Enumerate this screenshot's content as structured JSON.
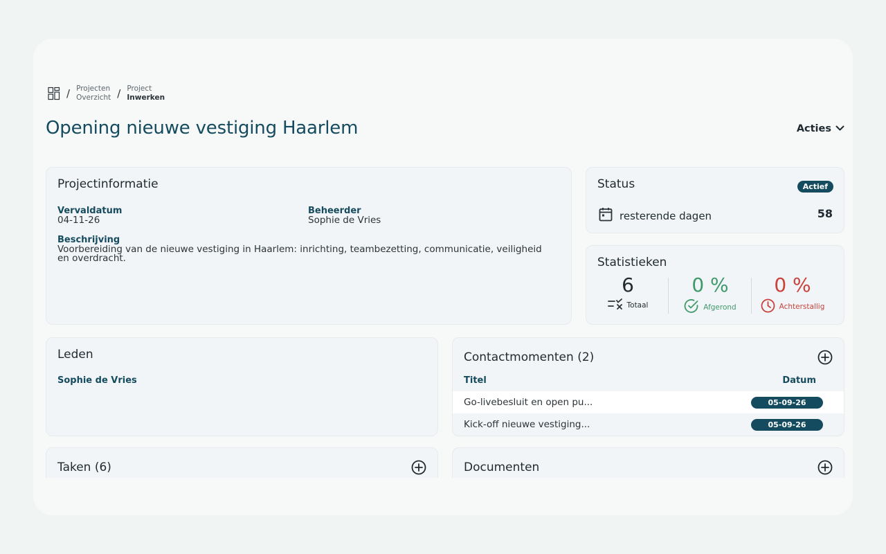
{
  "breadcrumb": [
    {
      "top": "Projecten",
      "bottom": "Overzicht"
    },
    {
      "top": "Project",
      "bottom": "Inwerken"
    }
  ],
  "page_title": "Opening nieuwe vestiging Haarlem",
  "actions_label": "Acties",
  "project_info": {
    "title": "Projectinformatie",
    "due_label": "Vervaldatum",
    "due_value": "04-11-26",
    "manager_label": "Beheerder",
    "manager_value": "Sophie de Vries",
    "description_label": "Beschrijving",
    "description_value": "Voorbereiding van de nieuwe vestiging in Haarlem: inrichting, teambezetting, communicatie, veiligheid en overdracht."
  },
  "status": {
    "title": "Status",
    "badge": "Actief",
    "days_label": "resterende dagen",
    "days_value": "58"
  },
  "statistics": {
    "title": "Statistieken",
    "total_value": "6",
    "total_label": "Totaal",
    "done_value": "0 %",
    "done_label": "Afgerond",
    "overdue_value": "0 %",
    "overdue_label": "Achterstallig"
  },
  "members": {
    "title": "Leden",
    "items": [
      "Sophie de Vries"
    ]
  },
  "contacts": {
    "title": "Contactmomenten (2)",
    "col_title": "Titel",
    "col_date": "Datum",
    "rows": [
      {
        "title": "Go-livebesluit en open pu...",
        "date": "05-09-26"
      },
      {
        "title": "Kick-off nieuwe vestiging...",
        "date": "05-09-26"
      }
    ]
  },
  "tasks": {
    "title": "Taken (6)"
  },
  "documents": {
    "title": "Documenten"
  },
  "colors": {
    "primary": "#154b5f",
    "success": "#3f9a6b",
    "danger": "#c9423b"
  }
}
